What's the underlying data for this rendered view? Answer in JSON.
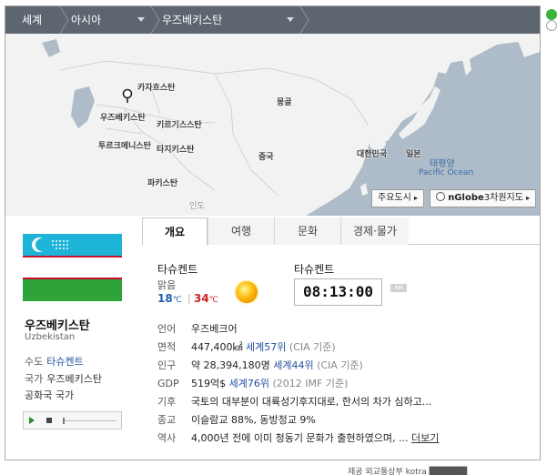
{
  "breadcrumb": {
    "world": "세계",
    "region": "아시아",
    "country": "우즈베키스탄"
  },
  "map": {
    "labels": {
      "kazakhstan": "카자흐스탄",
      "mongolia": "몽골",
      "uzbekistan": "우즈베키스탄",
      "kyrgyzstan": "키르기스스탄",
      "turkmenistan": "투르크메니스탄",
      "tajikistan": "타지키스탄",
      "pakistan": "파키스탄",
      "china": "중국",
      "korea": "대한민국",
      "japan": "일본",
      "india": "인도",
      "pacific_ko": "태평양",
      "pacific_en": "Pacific Ocean"
    },
    "buttons": {
      "major_cities": "주요도시",
      "globe_brand": "nGlobe",
      "globe_3d": "3차원지도"
    }
  },
  "country": {
    "name": "우즈베키스탄",
    "name_en": "Uzbekistan",
    "capital_label": "수도",
    "capital": "타슈켄트",
    "anthem_label": "국가",
    "anthem_value": "우즈베키스탄",
    "anthem_value2": "공화국 국가"
  },
  "tabs": [
    "개요",
    "여행",
    "문화",
    "경제·물가"
  ],
  "weather": {
    "city": "타슈켄트",
    "condition": "맑음",
    "low": "18",
    "high": "34",
    "unit": "℃",
    "sep": "|"
  },
  "time": {
    "city": "타슈켄트",
    "clock": "08:13:00",
    "ampm": "AM"
  },
  "facts": {
    "language": {
      "label": "언어",
      "value": "우즈베크어"
    },
    "area": {
      "label": "면적",
      "value": "447,400㎢",
      "rank": "세계57위",
      "source": "(CIA 기준)"
    },
    "population": {
      "label": "인구",
      "value": "약 28,394,180명",
      "rank": "세계44위",
      "source": "(CIA 기준)"
    },
    "gdp": {
      "label": "GDP",
      "value": "519억$",
      "rank": "세계76위",
      "source": "(2012 IMF 기준)"
    },
    "climate": {
      "label": "기후",
      "value": "국토의 대부분이 대륙성기후지대로, 한서의 차가 심하고..."
    },
    "religion": {
      "label": "종교",
      "value": "이슬람교 88%, 동방정교 9%"
    },
    "history": {
      "label": "역사",
      "value": "4,000년 전에 이미 청동기 문화가 출현하였으며, ...",
      "more": "더보기"
    }
  },
  "footer": {
    "text": "제공  외교통상부  kotra  ██████"
  },
  "colors": {
    "breadcrumb_bg": "#5d6670",
    "link": "#1f4f9e",
    "low_temp": "#1f5fb0",
    "high_temp": "#cc2222",
    "flag_blue": "#1eb4d8",
    "flag_green": "#2fa33a",
    "flag_red": "#c8102e"
  }
}
